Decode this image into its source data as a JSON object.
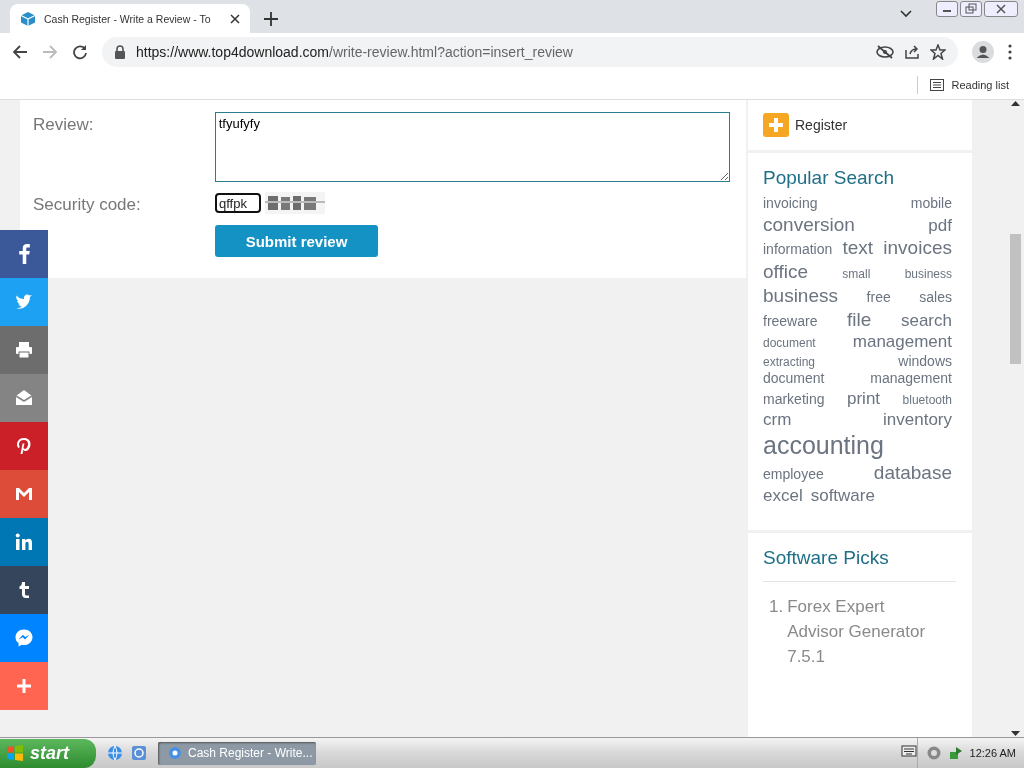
{
  "browser": {
    "tab": {
      "title": "Cash Register - Write a Review - To",
      "selected": true
    },
    "url_host": "https://www.top4download.com",
    "url_path": "/write-review.html?action=insert_review",
    "reading_list": "Reading list"
  },
  "form": {
    "fields": [
      {
        "label": "Review:",
        "kind": "textarea",
        "value": "tfyufyfy"
      },
      {
        "label": "Security code:",
        "kind": "captcha",
        "value": "qffpk"
      }
    ],
    "submit": "Submit review"
  },
  "sidebar": {
    "register": "Register",
    "popular_title": "Popular Search",
    "tag_rows": [
      [
        {
          "text": "invoicing",
          "kind": "s"
        },
        {
          "text": "mobile",
          "kind": "s"
        }
      ],
      [
        {
          "text": "conversion",
          "kind": "l"
        },
        {
          "text": "pdf",
          "kind": "m"
        }
      ],
      [
        {
          "text": "information",
          "kind": "s"
        },
        {
          "text": "text",
          "kind": "l"
        },
        {
          "text": "invoices",
          "kind": "l"
        }
      ],
      [
        {
          "text": "office",
          "kind": "l"
        },
        {
          "text": "small",
          "kind": "xs"
        },
        {
          "text": "business",
          "kind": "xs"
        }
      ],
      [
        {
          "text": "business",
          "kind": "l"
        },
        {
          "text": "free",
          "kind": "s"
        },
        {
          "text": "sales",
          "kind": "s"
        }
      ],
      [
        {
          "text": "freeware",
          "kind": "s"
        },
        {
          "text": "file",
          "kind": "l"
        },
        {
          "text": "search",
          "kind": "m"
        }
      ],
      [
        {
          "text": "document",
          "kind": "xs"
        },
        {
          "text": "management",
          "kind": "m"
        }
      ],
      [
        {
          "text": "extracting",
          "kind": "xs"
        },
        {
          "text": "windows",
          "kind": "s"
        }
      ],
      [
        {
          "text": "document",
          "kind": "s"
        },
        {
          "text": "management",
          "kind": "s"
        }
      ],
      [
        {
          "text": "marketing",
          "kind": "s"
        },
        {
          "text": "print",
          "kind": "m"
        },
        {
          "text": "bluetooth",
          "kind": "xs"
        }
      ],
      [
        {
          "text": "crm",
          "kind": "m"
        },
        {
          "text": "inventory",
          "kind": "m"
        }
      ],
      [
        {
          "text": "accounting",
          "kind": "xl"
        }
      ],
      [
        {
          "text": "employee",
          "kind": "s"
        },
        {
          "text": "database",
          "kind": "l"
        }
      ],
      [
        {
          "text": "excel",
          "kind": "m"
        },
        {
          "text": "software",
          "kind": "m"
        }
      ]
    ],
    "picks_title": "Software Picks",
    "picks": [
      {
        "number": "1.",
        "title": "Forex Expert Advisor Generator 7.5.1"
      }
    ]
  },
  "share_buttons": [
    {
      "kind": "facebook",
      "color": "#3b5998"
    },
    {
      "kind": "twitter",
      "color": "#1da1f2"
    },
    {
      "kind": "print",
      "color": "#6d6d6d"
    },
    {
      "kind": "email",
      "color": "#848484"
    },
    {
      "kind": "pinterest",
      "color": "#cb2027"
    },
    {
      "kind": "gmail",
      "color": "#dd4b39"
    },
    {
      "kind": "linkedin",
      "color": "#0077b5"
    },
    {
      "kind": "tumblr",
      "color": "#35465c"
    },
    {
      "kind": "messenger",
      "color": "#0084ff"
    },
    {
      "kind": "more",
      "color": "#ff6550"
    }
  ],
  "taskbar": {
    "start": "start",
    "windows": [
      {
        "title": "Cash Register - Write...",
        "selected": true
      }
    ],
    "clock": "12:26 AM"
  }
}
